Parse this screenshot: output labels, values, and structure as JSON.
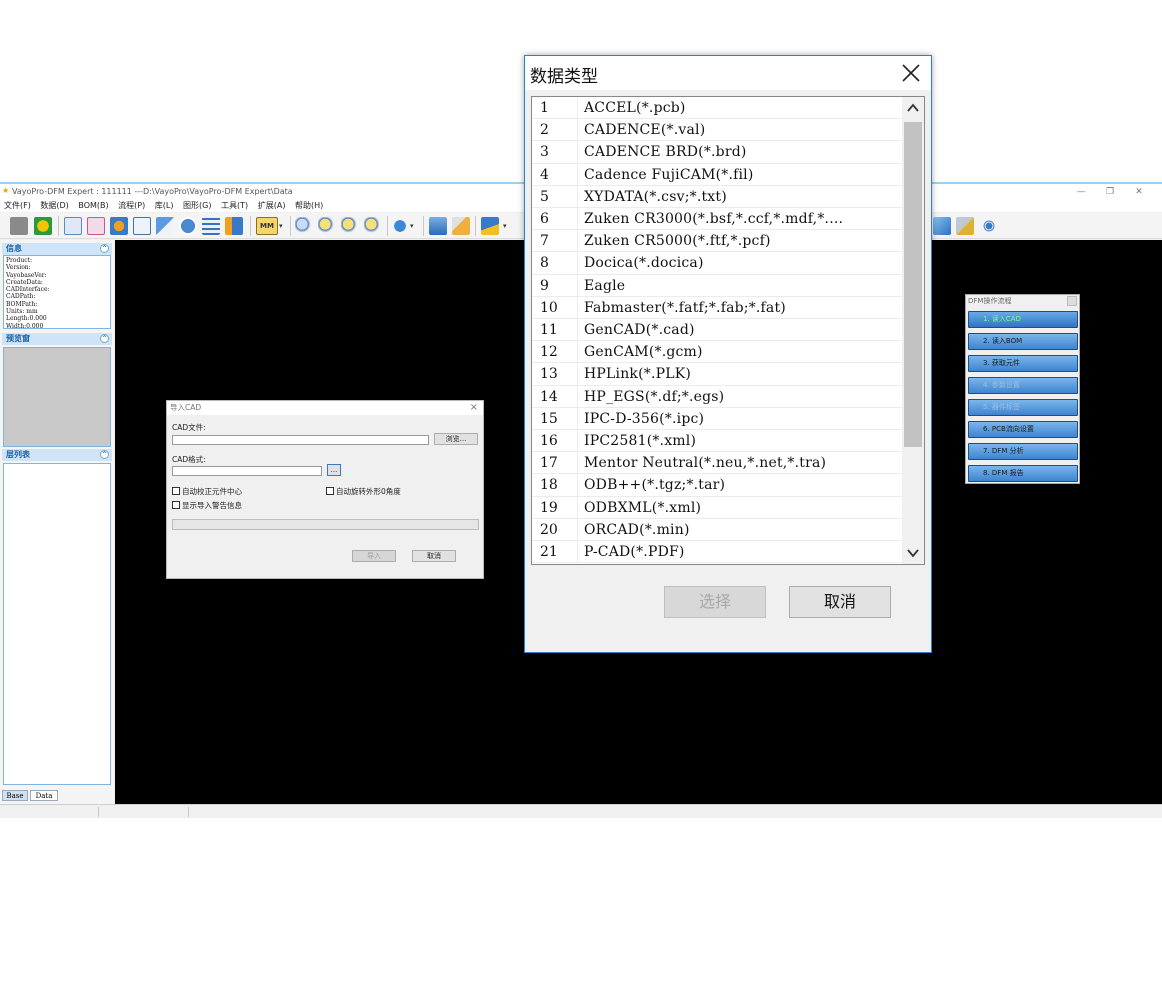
{
  "app": {
    "title": "VayoPro-DFM Expert : 111111  ---D:\\VayoPro\\VayoPro-DFM Expert\\Data",
    "menu": [
      "文件(F)",
      "数据(D)",
      "BOM(B)",
      "流程(P)",
      "库(L)",
      "图形(G)",
      "工具(T)",
      "扩展(A)",
      "帮助(H)"
    ],
    "toolbar_mm_label": "MM",
    "window_controls": [
      "—",
      "❐",
      "✕"
    ]
  },
  "left_panel": {
    "info_header": "信息",
    "info_lines": [
      "Product:",
      "Version:",
      "VayobaseVer:",
      "CreateData:",
      "CADInterface:",
      "CADPath:",
      "BOMPath:",
      "Units: mm",
      "Length:0.000",
      "Width:0.000"
    ],
    "preview_header": "预览窗",
    "layer_header": "层列表",
    "tabs": [
      "Base",
      "Data"
    ]
  },
  "import_cad": {
    "title": "导入CAD",
    "cad_file_label": "CAD文件:",
    "browse_label": "浏览...",
    "cad_format_label": "CAD格式:",
    "format_button_label": "...",
    "check_center": "自动校正元件中心",
    "check_rotate": "自动旋转外形0角度",
    "check_warn": "显示导入警告信息",
    "import_label": "导入",
    "cancel_label": "取消"
  },
  "dfm_flow": {
    "title": "DFM操作流程",
    "steps": [
      "1. 读入CAD",
      "2. 读入BOM",
      "3. 获取元件",
      "4. 参数设置",
      "5. 器件标签",
      "6. PCB流向设置",
      "7. DFM 分析",
      "8. DFM 报告"
    ],
    "active_step": 1,
    "disabled_steps": [
      4,
      5
    ]
  },
  "data_type_dialog": {
    "title": "数据类型",
    "items": [
      {
        "num": "1",
        "name": "ACCEL(*.pcb)"
      },
      {
        "num": "2",
        "name": "CADENCE(*.val)"
      },
      {
        "num": "3",
        "name": "CADENCE BRD(*.brd)"
      },
      {
        "num": "4",
        "name": "Cadence FujiCAM(*.fil)"
      },
      {
        "num": "5",
        "name": "XYDATA(*.csv;*.txt)"
      },
      {
        "num": "6",
        "name": "Zuken CR3000(*.bsf,*.ccf,*.mdf,*...."
      },
      {
        "num": "7",
        "name": "Zuken CR5000(*.ftf,*.pcf)"
      },
      {
        "num": "8",
        "name": "Docica(*.docica)"
      },
      {
        "num": "9",
        "name": "Eagle"
      },
      {
        "num": "10",
        "name": "Fabmaster(*.fatf;*.fab;*.fat)"
      },
      {
        "num": "11",
        "name": "GenCAD(*.cad)"
      },
      {
        "num": "12",
        "name": "GenCAM(*.gcm)"
      },
      {
        "num": "13",
        "name": "HPLink(*.PLK)"
      },
      {
        "num": "14",
        "name": "HP_EGS(*.df;*.egs)"
      },
      {
        "num": "15",
        "name": "IPC-D-356(*.ipc)"
      },
      {
        "num": "16",
        "name": "IPC2581(*.xml)"
      },
      {
        "num": "17",
        "name": "Mentor Neutral(*.neu,*.net,*.tra)"
      },
      {
        "num": "18",
        "name": "ODB++(*.tgz;*.tar)"
      },
      {
        "num": "19",
        "name": "ODBXML(*.xml)"
      },
      {
        "num": "20",
        "name": "ORCAD(*.min)"
      },
      {
        "num": "21",
        "name": "P-CAD(*.PDF)"
      }
    ],
    "select_label": "选择",
    "cancel_label": "取消"
  }
}
